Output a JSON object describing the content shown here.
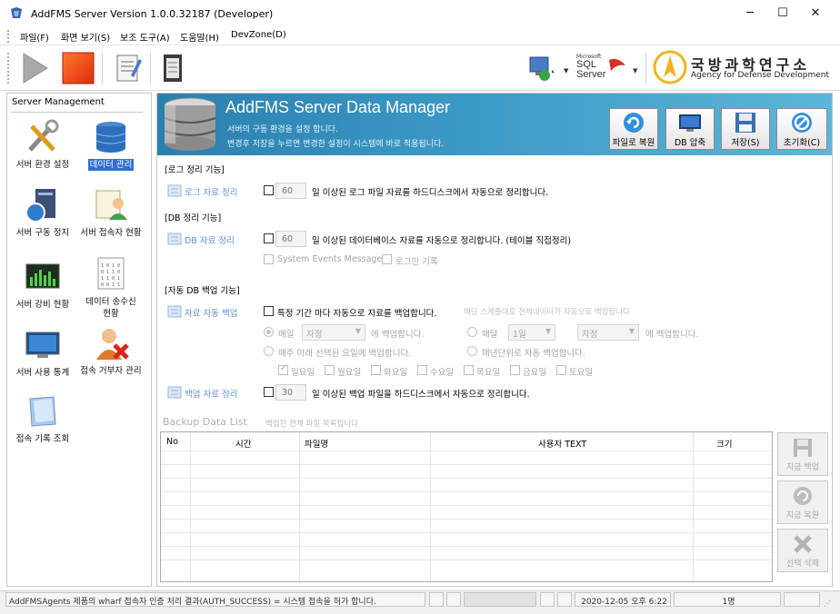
{
  "window": {
    "title": "AddFMS Server Version 1.0.0.32187 (Developer)",
    "controls": {
      "minimize": "─",
      "maximize": "☐",
      "close": "✕"
    }
  },
  "menu": [
    "파일(F)",
    "화면 보기(S)",
    "보조 도구(A)",
    "도움말(H)",
    "DevZone(D)"
  ],
  "toolbar": {
    "buttons": [
      "play-icon",
      "stop-icon",
      "notepad-icon",
      "document-icon",
      "network-monitor-icon",
      "sql-server-icon"
    ],
    "sql_small": "Microsoft",
    "sql_big": "SQL Server"
  },
  "org": {
    "name_kr": "국방과학연구소",
    "name_en": "Agency for Defense Development"
  },
  "sidebar": {
    "title": "Server Management",
    "items": [
      {
        "label": "서버 환경 설정",
        "icon": "tools-icon"
      },
      {
        "label": "데이터 관리",
        "icon": "database-icon"
      },
      {
        "label": "서버 구동 정지",
        "icon": "server-power-icon"
      },
      {
        "label": "서버 접속자 현황",
        "icon": "user-list-icon"
      },
      {
        "label": "서버 강비 현황",
        "icon": "equalizer-icon"
      },
      {
        "label": "데이터 송수신 현황",
        "icon": "data-table-icon"
      },
      {
        "label": "서버 사용 통계",
        "icon": "monitor-chart-icon"
      },
      {
        "label": "접속 거부자 관리",
        "icon": "user-deny-icon"
      },
      {
        "label": "접속 기록 조회",
        "icon": "log-book-icon"
      }
    ]
  },
  "banner": {
    "title": "AddFMS Server Data Manager",
    "sub1": "서버의 구동 환경을 설정 합니다.",
    "sub2": "변경후 저장을 누르면 변경한 설정이 시스템에 바로 적용됩니다.",
    "buttons": [
      {
        "label": "파일로 복원",
        "icon": "refresh-icon"
      },
      {
        "label": "DB 압축",
        "icon": "monitor-icon"
      },
      {
        "label": "저장(S)",
        "icon": "floppy-icon"
      },
      {
        "label": "초기화(C)",
        "icon": "no-icon"
      }
    ]
  },
  "log_section": {
    "header": "[로그 정리 기능]",
    "link": "로그 자료 정리",
    "days": "60",
    "desc": "일 이상된 로그 파일 자료를 하드디스크에서 자동으로 정리합니다."
  },
  "db_section": {
    "header": "[DB 정리 기능]",
    "link": "DB 자료 정리",
    "days": "60",
    "desc": "일 이상된 데이터베이스 자료를 자동으로 정리합니다. (테이블 직접정리)",
    "opt1": "System Events Message",
    "opt2": "로그인 기록"
  },
  "backup_section": {
    "header": "[자동 DB 백업 기능]",
    "link": "자료 자동 백업",
    "periodic": "특정 기간 마다 자동으로 자료를 백업합니다.",
    "hint": "해당 스케줄대로 전체데이터가 자동으로 백업됩니다",
    "daily": "매일",
    "daily_sel": "자정",
    "daily_suffix": "에 백업합니다.",
    "monthly": "매달",
    "monthly_day": "1일",
    "monthly_time": "자정",
    "monthly_suffix": "에 백업합니다.",
    "weekday_opt": "매주 아래 선택된 요일에 백업합니다.",
    "yearly_opt": "매년단위로 자동 백업합니다.",
    "days": [
      "일요일",
      "월요일",
      "화요일",
      "수요일",
      "목요일",
      "금요일",
      "토요일"
    ],
    "cleanup_link": "백업 자료 정리",
    "cleanup_days": "30",
    "cleanup_desc": "일 이상된 백업 파일을 하드디스크에서 자동으로 정리합니다."
  },
  "backup_list": {
    "title": "Backup Data List",
    "subtitle": "백업된 전체 파일 목록입니다",
    "columns": [
      "No",
      "시간",
      "파일명",
      "사용자 TEXT",
      "크기"
    ],
    "buttons": [
      {
        "label": "지금 백업",
        "icon": "floppy-icon"
      },
      {
        "label": "지금 복원",
        "icon": "refresh-icon"
      },
      {
        "label": "선택 삭제",
        "icon": "delete-icon"
      }
    ]
  },
  "status": {
    "message": "AddFMSAgents 제품의 wharf 접속자 인증 처리 결과(AUTH_SUCCESS) = 시스템 접속을 허가 합니다.",
    "datetime": "2020-12-05 오후 6:22",
    "users": "1명"
  },
  "colors": {
    "banner": "#3b99c6",
    "active": "#2f6fd0",
    "link": "#5b8fd6"
  }
}
